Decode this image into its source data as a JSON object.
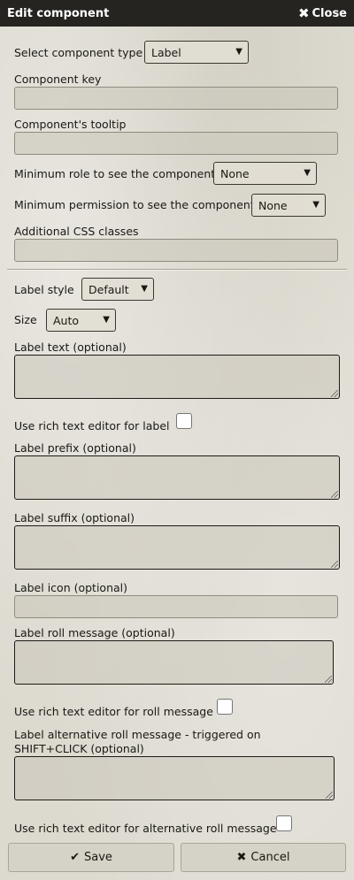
{
  "window": {
    "title": "Edit component",
    "close_label": "Close"
  },
  "fields": {
    "component_type": {
      "label": "Select component type",
      "value": "Label"
    },
    "component_key": {
      "label": "Component key",
      "value": ""
    },
    "tooltip": {
      "label": "Component's tooltip",
      "value": ""
    },
    "min_role": {
      "label": "Minimum role to see the component",
      "value": "None"
    },
    "min_permission": {
      "label": "Minimum permission to see the component",
      "value": "None"
    },
    "css_classes": {
      "label": "Additional CSS classes",
      "value": ""
    },
    "label_style": {
      "label": "Label style",
      "value": "Default"
    },
    "size": {
      "label": "Size",
      "value": "Auto"
    },
    "label_text": {
      "label": "Label text (optional)",
      "value": ""
    },
    "rich_label": {
      "label": "Use rich text editor for label",
      "checked": false
    },
    "label_prefix": {
      "label": "Label prefix (optional)",
      "value": ""
    },
    "label_suffix": {
      "label": "Label suffix (optional)",
      "value": ""
    },
    "label_icon": {
      "label": "Label icon (optional)",
      "value": ""
    },
    "roll_message": {
      "label": "Label roll message (optional)",
      "value": ""
    },
    "rich_roll": {
      "label": "Use rich text editor for roll message",
      "checked": false
    },
    "alt_roll_message": {
      "label": "Label alternative roll message - triggered on SHIFT+CLICK (optional)",
      "value": ""
    },
    "rich_alt_roll": {
      "label": "Use rich text editor for alternative roll message",
      "checked": false
    }
  },
  "buttons": {
    "save": "Save",
    "cancel": "Cancel"
  },
  "icons": {
    "close": "close-icon",
    "save": "check-icon",
    "cancel": "x-icon",
    "dropdown": "chevron-down-icon"
  }
}
